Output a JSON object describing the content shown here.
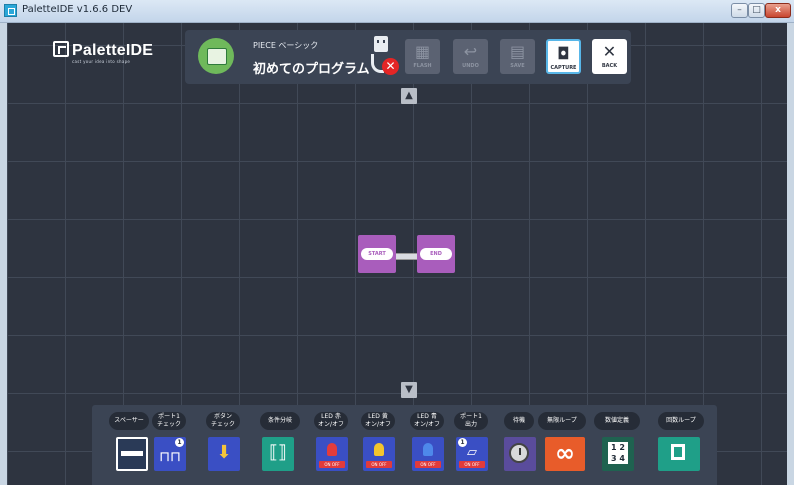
{
  "window": {
    "title": "PaletteIDE v1.6.6 DEV",
    "controls": {
      "minimize": "–",
      "maximize": "□",
      "close": "x"
    }
  },
  "logo": {
    "name": "PaletteIDE",
    "tagline": "cast your idea into shape"
  },
  "toolbar": {
    "course": "PIECE ベーシック",
    "program": "初めてのプログラム",
    "connection_status_icon": "usb-disconnected-icon",
    "buttons": [
      {
        "label": "FLASH",
        "glyph": "▦",
        "enabled": false
      },
      {
        "label": "UNDO",
        "glyph": "↩",
        "enabled": false
      },
      {
        "label": "SAVE",
        "glyph": "▤",
        "enabled": false
      },
      {
        "label": "CAPTURE",
        "glyph": "◘",
        "enabled": true
      },
      {
        "label": "BACK",
        "glyph": "✕",
        "enabled": true
      }
    ]
  },
  "canvas": {
    "scroll_up": "▲",
    "scroll_down": "▼",
    "nodes": {
      "start": "START",
      "end": "END"
    }
  },
  "palette": {
    "items": [
      {
        "label": "スペーサー"
      },
      {
        "label": "ポート1\nチェック",
        "badge": "1"
      },
      {
        "label": "ボタン\nチェック"
      },
      {
        "label": "条件分岐"
      },
      {
        "label": "LED 赤\nオン/オフ",
        "onoff": "ON OFF"
      },
      {
        "label": "LED 黄\nオン/オフ",
        "onoff": "ON OFF"
      },
      {
        "label": "LED 青\nオン/オフ",
        "onoff": "ON OFF"
      },
      {
        "label": "ポート1\n出力",
        "badge": "1",
        "onoff": "ON OFF"
      },
      {
        "label": "待機"
      },
      {
        "label": "無限ループ",
        "glyph": "∞"
      },
      {
        "label": "数値定義",
        "numbers": "1 2\n3 4"
      },
      {
        "label": "回数ループ"
      }
    ]
  },
  "colors": {
    "canvas_bg": "#2e3440",
    "panel_bg": "#3b4454",
    "node_purple": "#a95dbc",
    "accent_capture": "#58b6e8",
    "error_red": "#e42525"
  }
}
